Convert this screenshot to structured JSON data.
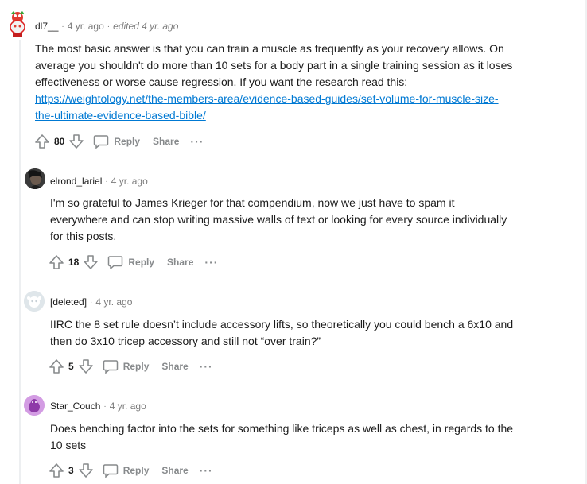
{
  "comments": [
    {
      "author": "dl7__",
      "time": "4 yr. ago",
      "edited": "edited 4 yr. ago",
      "body": [
        "The most basic answer is that you can train a muscle as frequently as your recovery allows. On",
        "average you shouldn't do more than 10 sets for a body part in a single training session as it loses",
        "effectiveness or worse cause regression. If you want the research read this:"
      ],
      "link": [
        "https://weightology.net/the-members-area/evidence-based-guides/set-volume-for-muscle-size-",
        "the-ultimate-evidence-based-bible/"
      ],
      "score": "80",
      "reply_label": "Reply",
      "share_label": "Share",
      "more_label": "···"
    },
    {
      "author": "elrond_lariel",
      "time": "4 yr. ago",
      "body": [
        "I'm so grateful to James Krieger for that compendium, now we just have to spam it",
        "everywhere and can stop writing massive walls of text or looking for every source individually",
        "for this posts."
      ],
      "score": "18",
      "reply_label": "Reply",
      "share_label": "Share",
      "more_label": "···"
    },
    {
      "author": "[deleted]",
      "time": "4 yr. ago",
      "body": [
        "IIRC the 8 set rule doesn’t include accessory lifts, so theoretically you could bench a 6x10 and",
        "then do 3x10 tricep accessory and still not “over train?”"
      ],
      "score": "5",
      "reply_label": "Reply",
      "share_label": "Share",
      "more_label": "···"
    },
    {
      "author": "Star_Couch",
      "time": "4 yr. ago",
      "body": [
        "Does benching factor into the sets for something like triceps as well as chest, in regards to the",
        "10 sets"
      ],
      "score": "3",
      "reply_label": "Reply",
      "share_label": "Share",
      "more_label": "···"
    }
  ]
}
